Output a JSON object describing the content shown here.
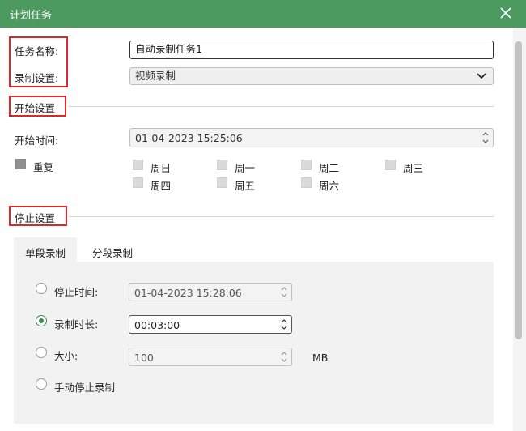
{
  "window": {
    "title": "计划任务"
  },
  "task": {
    "name_label": "任务名称:",
    "name_value": "自动录制任务1",
    "record_label": "录制设置:",
    "record_value": "视频录制"
  },
  "start": {
    "section_title": "开始设置",
    "time_label": "开始时间:",
    "time_value": "01-04-2023 15:25:06",
    "repeat_label": "重复",
    "days": [
      "周日",
      "周一",
      "周二",
      "周三",
      "周四",
      "周五",
      "周六"
    ]
  },
  "stop": {
    "section_title": "停止设置",
    "tabs": [
      "单段录制",
      "分段录制"
    ],
    "active_tab": "单段录制",
    "options": {
      "stop_time_label": "停止时间:",
      "stop_time_value": "01-04-2023 15:28:06",
      "duration_label": "录制时长:",
      "duration_value": "00:03:00",
      "size_label": "大小:",
      "size_value": "100",
      "size_unit": "MB",
      "manual_label": "手动停止录制"
    },
    "selected_option": "录制时长"
  },
  "colors": {
    "titlebar": "#4c9a5f",
    "highlight_box": "#e0262a",
    "radio_accent": "#3a8a50"
  }
}
